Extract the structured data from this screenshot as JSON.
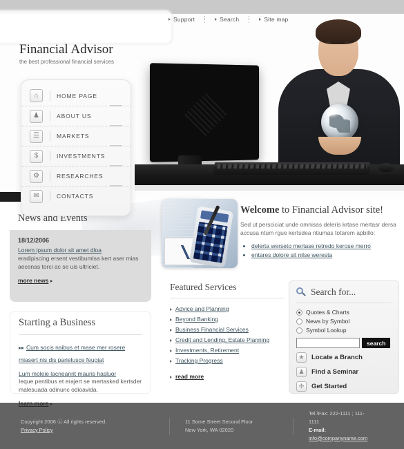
{
  "topnav": {
    "items": [
      {
        "label": "Support",
        "icon": "chevron-right-icon"
      },
      {
        "label": "Search",
        "icon": "chevron-right-icon"
      },
      {
        "label": "Site map",
        "icon": "chevron-right-icon"
      }
    ]
  },
  "brand": {
    "title": "Financial Advisor",
    "tagline": "the best professional financial services"
  },
  "menu": {
    "items": [
      {
        "label": "HOME PAGE",
        "icon": "home-icon",
        "glyph": "⌂"
      },
      {
        "label": "ABOUT US",
        "icon": "people-icon",
        "glyph": "♟"
      },
      {
        "label": "MARKETS",
        "icon": "document-icon",
        "glyph": "☰"
      },
      {
        "label": "INVESTMENTS",
        "icon": "dollar-icon",
        "glyph": "$"
      },
      {
        "label": "RESEARCHES",
        "icon": "gear-icon",
        "glyph": "⚙"
      },
      {
        "label": "CONTACTS",
        "icon": "envelope-icon",
        "glyph": "✉"
      }
    ]
  },
  "news": {
    "title": "News and Events",
    "date": "18/12/2006",
    "headline": "Lorem ipsum dolor sit amet dloa",
    "text": "eradipiscing ersent vestibumlsa kert aser mias aecenas torci ac se uis ultriciet.",
    "more_label": "more news"
  },
  "business": {
    "title": "Starting a Business",
    "lead": "Cum socis naibus et mase mer rosere miasert nis dis parielusce feugiat",
    "sub_link": "Lum moleie lacneanrit mauris hasluor",
    "text": "Ieque pentibus et erajert se mertasked kertsder malesuada odinunc odioavida.",
    "more_label": "learn more"
  },
  "welcome": {
    "title_bold": "Welcome",
    "title_rest": " to Financial Advisor site!",
    "paragraph": "Sed ut persciciat unde omnisas deleris krtase mertasr dersa accusa ntum rgue kertsdea ntiumas totarem apbillo:",
    "bullets": [
      "delerta werseto mertase retredo kerose merro",
      "entares dolore sit nilse weresta"
    ]
  },
  "featured": {
    "title": "Featured Services",
    "items": [
      "Advice and Planning",
      "Beyond Banking",
      "Business Financial Services",
      "Credit and Lending, Estate Planning",
      "Investments, Retirement",
      "Tracking Progress"
    ],
    "more_label": "read more"
  },
  "search": {
    "title": "Search for...",
    "icon": "magnifier-icon",
    "options": [
      {
        "label": "Quotes & Charts",
        "selected": true
      },
      {
        "label": "News by Symbol",
        "selected": false
      },
      {
        "label": "Symbol Lookup",
        "selected": false
      }
    ],
    "input_value": "",
    "input_placeholder": "",
    "button_label": "search",
    "quick_links": [
      {
        "label": "Locate a Branch",
        "icon": "star-icon",
        "glyph": "★"
      },
      {
        "label": "Find a Seminar",
        "icon": "calendar-icon",
        "glyph": "♟"
      },
      {
        "label": "Get Started",
        "icon": "plus-icon",
        "glyph": "✣"
      }
    ]
  },
  "footer": {
    "copyright": "Copyright 2006 ⓒ All rights reserved.",
    "privacy": "Privacy Policy",
    "address_line1": "11 Some Street Second Floor",
    "address_line2": "New York, WA 02020",
    "phone": "Tel.\\Fax: 222-1111 ; 111-1111",
    "email_label": "E-mail:",
    "email": "info@companyname.com"
  },
  "colors": {
    "footer_bg": "#636363",
    "topbar_bg": "#c9c9c9",
    "news_bg": "#dcdcdc",
    "link": "#3f5560",
    "button_bg": "#111111"
  }
}
